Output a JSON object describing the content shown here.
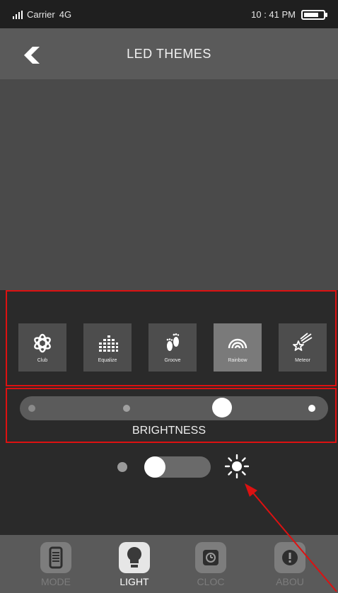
{
  "status_bar": {
    "carrier": "Carrier",
    "network": "4G",
    "time": "10 : 41 PM",
    "battery_level": 0.75
  },
  "header": {
    "title": "LED THEMES",
    "back_icon": "back-arrow-icon"
  },
  "themes": {
    "items": [
      {
        "label": "Club",
        "icon": "club-atom-icon",
        "active": false
      },
      {
        "label": "Equalize",
        "icon": "equalizer-bars-icon",
        "active": false
      },
      {
        "label": "Groove",
        "icon": "footprints-icon",
        "active": false
      },
      {
        "label": "Rainbow",
        "icon": "rainbow-icon",
        "active": true
      },
      {
        "label": "Meteor",
        "icon": "shooting-star-icon",
        "active": false
      }
    ]
  },
  "brightness": {
    "label": "BRIGHTNESS",
    "level": 0.67
  },
  "toggle": {
    "on": false
  },
  "nav": {
    "items": [
      {
        "label": "MODE",
        "icon": "phone-icon",
        "active": false
      },
      {
        "label": "LIGHT",
        "icon": "bulb-icon",
        "active": true
      },
      {
        "label": "CLOC",
        "icon": "clock-icon",
        "active": false
      },
      {
        "label": "ABOU",
        "icon": "info-icon",
        "active": false
      }
    ]
  },
  "colors": {
    "accent": "#dd1111",
    "background": "#2a2a2a",
    "header": "#5a5a5a"
  }
}
